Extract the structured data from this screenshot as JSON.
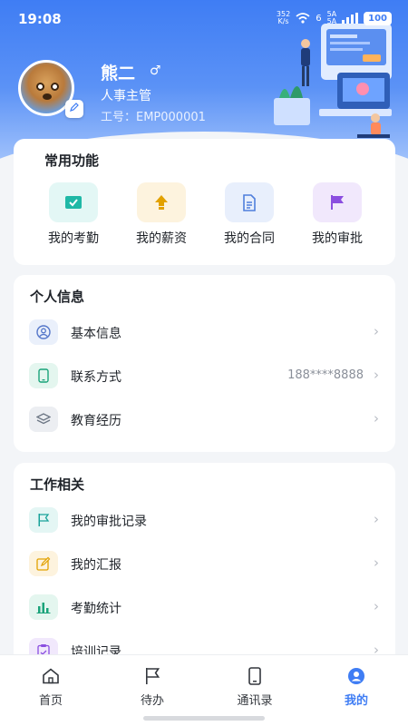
{
  "status": {
    "time": "19:08",
    "net_speed_value": "352",
    "net_speed_unit": "K/s",
    "wifi_label": "6",
    "sim1": "5A",
    "sim2": "5A",
    "battery": "100"
  },
  "profile": {
    "name": "熊二",
    "gender_symbol": "♂",
    "role": "人事主管",
    "employee_no": "工号：EMP000001"
  },
  "quick": {
    "title": "常用功能",
    "items": [
      {
        "label": "我的考勤",
        "icon": "check-icon",
        "color": "#1fb8a6",
        "bg": "#e3f7f5"
      },
      {
        "label": "我的薪资",
        "icon": "money-arrow-icon",
        "color": "#e2a100",
        "bg": "#fdf3de"
      },
      {
        "label": "我的合同",
        "icon": "document-icon",
        "color": "#4f7fdc",
        "bg": "#e8effc"
      },
      {
        "label": "我的审批",
        "icon": "flag-icon",
        "color": "#8b4ee0",
        "bg": "#f1e8fc"
      }
    ]
  },
  "personal": {
    "title": "个人信息",
    "rows": [
      {
        "label": "基本信息",
        "value": "",
        "icon": "user-icon",
        "color": "#5476c9",
        "bg": "#eaf0fb"
      },
      {
        "label": "联系方式",
        "value": "188****8888",
        "icon": "phone-icon",
        "color": "#1aa37a",
        "bg": "#e4f6ef"
      },
      {
        "label": "教育经历",
        "value": "",
        "icon": "layers-icon",
        "color": "#6d7785",
        "bg": "#eceef2"
      }
    ]
  },
  "work": {
    "title": "工作相关",
    "rows": [
      {
        "label": "我的审批记录",
        "icon": "flag-icon",
        "color": "#1aa39a",
        "bg": "#e4f6f4"
      },
      {
        "label": "我的汇报",
        "icon": "edit-icon",
        "color": "#e2a100",
        "bg": "#fdf3de"
      },
      {
        "label": "考勤统计",
        "icon": "bar-chart-icon",
        "color": "#1aa37a",
        "bg": "#e4f6ef"
      },
      {
        "label": "培训记录",
        "icon": "clipboard-icon",
        "color": "#8b4ee0",
        "bg": "#f1e8fc"
      }
    ]
  },
  "tabs": [
    {
      "label": "首页",
      "icon": "home-icon"
    },
    {
      "label": "待办",
      "icon": "flag-icon"
    },
    {
      "label": "通讯录",
      "icon": "phone-icon"
    },
    {
      "label": "我的",
      "icon": "user-icon",
      "active": true
    }
  ],
  "colors": {
    "accent": "#3f7df4"
  }
}
